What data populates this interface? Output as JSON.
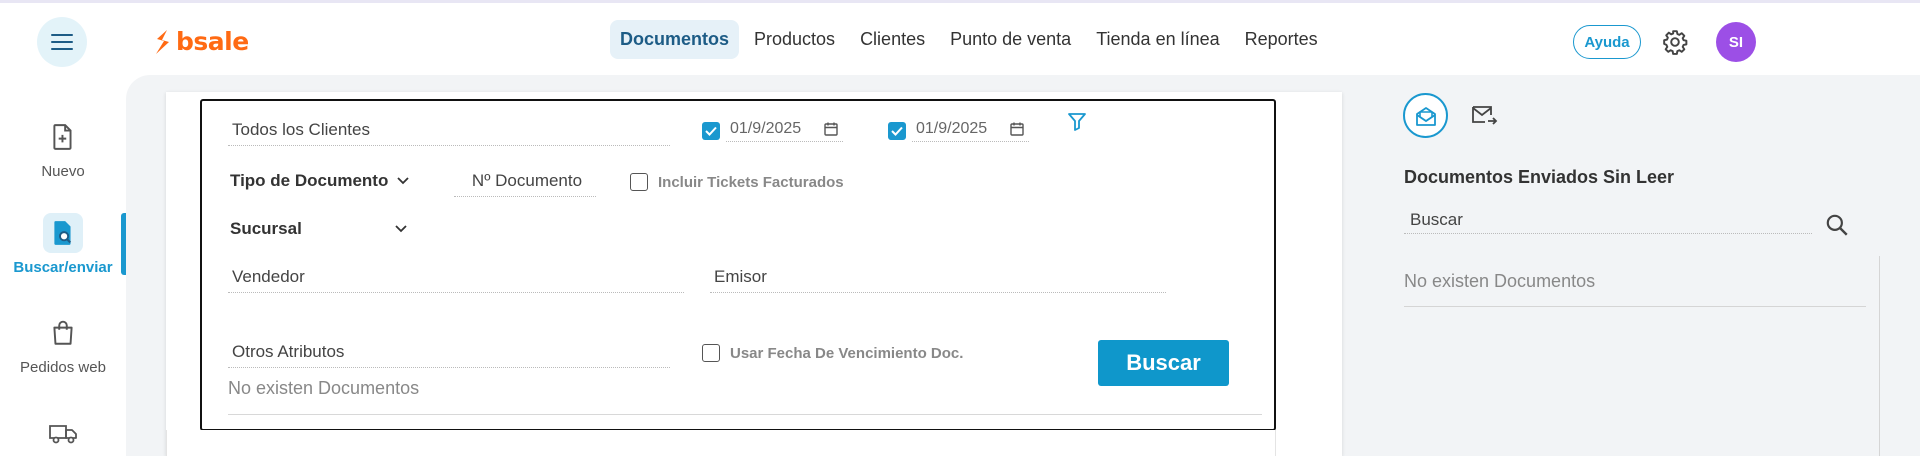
{
  "brand": {
    "name": "bsale",
    "color": "#ff6a13"
  },
  "header": {
    "nav": [
      {
        "label": "Documentos",
        "active": true
      },
      {
        "label": "Productos",
        "active": false
      },
      {
        "label": "Clientes",
        "active": false
      },
      {
        "label": "Punto de venta",
        "active": false
      },
      {
        "label": "Tienda en línea",
        "active": false
      },
      {
        "label": "Reportes",
        "active": false
      }
    ],
    "help_label": "Ayuda",
    "avatar_initials": "SI"
  },
  "sidebar": {
    "items": [
      {
        "label": "Nuevo",
        "icon": "file-plus-icon",
        "active": false
      },
      {
        "label": "Buscar/enviar",
        "icon": "file-search-icon",
        "active": true
      },
      {
        "label": "Pedidos web",
        "icon": "shopping-bag-icon",
        "active": false
      },
      {
        "label": "",
        "icon": "truck-icon",
        "active": false
      }
    ]
  },
  "filters": {
    "client_placeholder": "Todos los Clientes",
    "date_from": {
      "value": "01/9/2025",
      "checked": true
    },
    "date_to": {
      "value": "01/9/2025",
      "checked": true
    },
    "doc_type_label": "Tipo de Documento",
    "doc_number_placeholder": "Nº Documento",
    "include_tickets_label": "Incluir Tickets Facturados",
    "include_tickets_checked": false,
    "branch_label": "Sucursal",
    "seller_placeholder": "Vendedor",
    "issuer_placeholder": "Emisor",
    "other_attrs_placeholder": "Otros Atributos",
    "use_due_date_label": "Usar Fecha De Vencimiento Doc.",
    "use_due_date_checked": false,
    "search_button": "Buscar",
    "empty_message": "No existen Documentos"
  },
  "right_panel": {
    "title": "Documentos Enviados Sin Leer",
    "search_placeholder": "Buscar",
    "empty_message": "No existen Documentos"
  },
  "colors": {
    "accent": "#1a98cf",
    "button": "#0f97cb",
    "avatar": "#9c4fe6",
    "nav_active_bg": "#e6f1f8"
  }
}
